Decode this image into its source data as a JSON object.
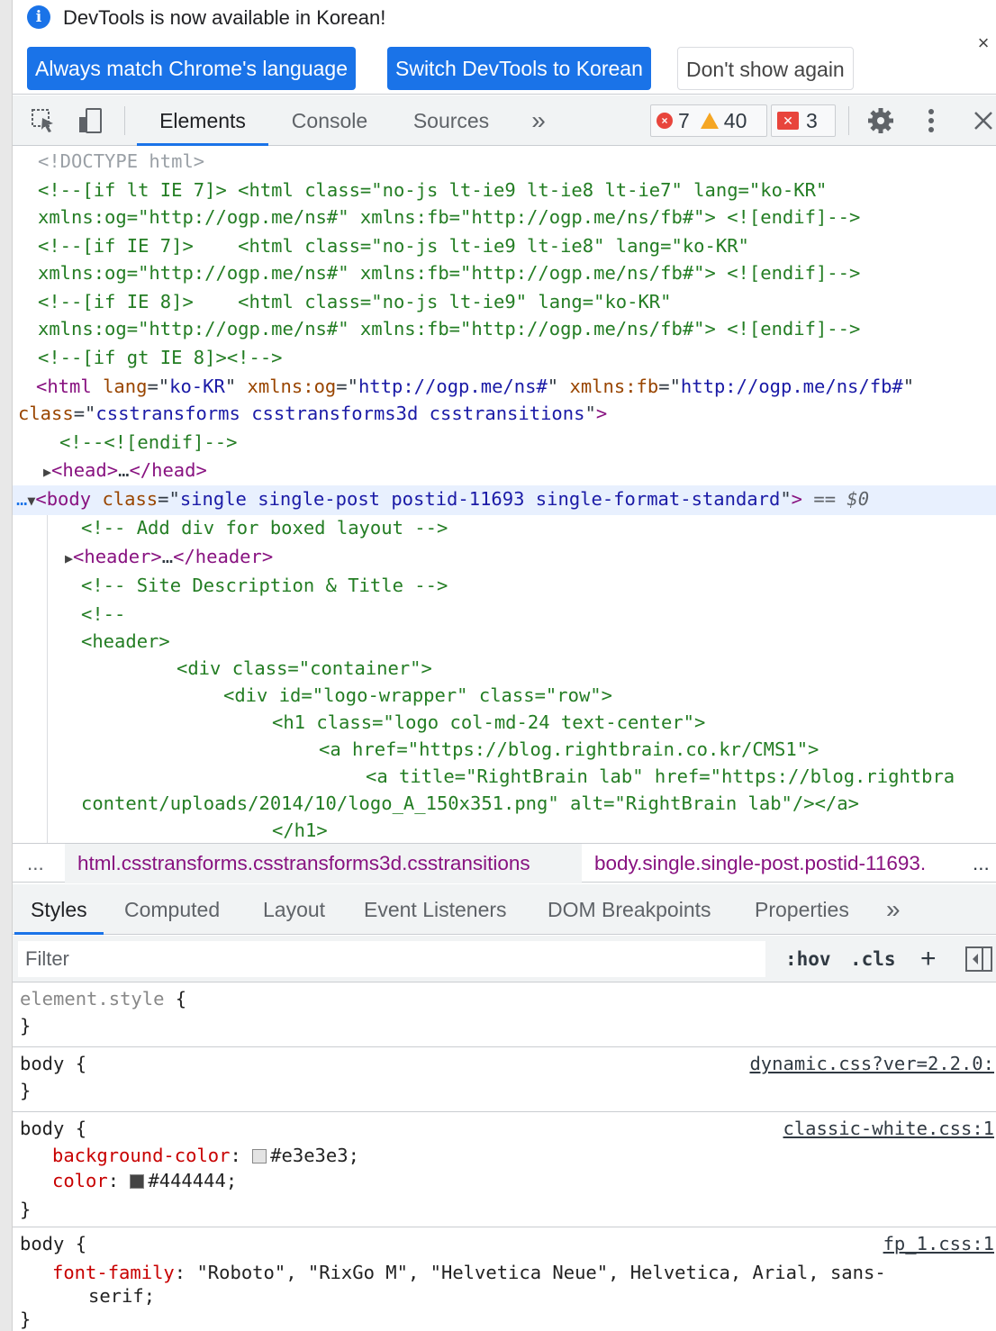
{
  "infobar": {
    "message": "DevTools is now available in Korean!",
    "btn_match": "Always match Chrome's language",
    "btn_switch": "Switch DevTools to Korean",
    "btn_dont_show": "Don't show again",
    "close": "×"
  },
  "toolbar": {
    "tabs": [
      "Elements",
      "Console",
      "Sources"
    ],
    "more": "»",
    "errors": "7",
    "warnings": "40",
    "issues": "3"
  },
  "tree": {
    "l1": "<!DOCTYPE html>",
    "l2": "<!--[if lt IE 7]> <html class=\"no-js lt-ie9 lt-ie8 lt-ie7\" lang=\"ko-KR\"",
    "l3": "xmlns:og=\"http://ogp.me/ns#\" xmlns:fb=\"http://ogp.me/ns/fb#\"> <![endif]-->",
    "l4": "<!--[if IE 7]>    <html class=\"no-js lt-ie9 lt-ie8\" lang=\"ko-KR\"",
    "l5": "xmlns:og=\"http://ogp.me/ns#\" xmlns:fb=\"http://ogp.me/ns/fb#\"> <![endif]-->",
    "l6": "<!--[if IE 8]>    <html class=\"no-js lt-ie9\" lang=\"ko-KR\"",
    "l7": "xmlns:og=\"http://ogp.me/ns#\" xmlns:fb=\"http://ogp.me/ns/fb#\"> <![endif]-->",
    "l8": "<!--[if gt IE 8]><!-->",
    "html_lang": "ko-KR",
    "html_og": "http://ogp.me/ns#",
    "html_fb": "http://ogp.me/ns/fb#",
    "html_class": "csstransforms csstransforms3d csstransitions",
    "l11": "<!--<![endif]-->",
    "body_class": "single single-post postid-11693 single-format-standard",
    "eq0": "== $0",
    "c1": "<!-- Add div for boxed layout -->",
    "c2": "<!-- Site Description & Title -->",
    "c3": "<!--",
    "c4": "<header>",
    "c5": "<div class=\"container\">",
    "c6": "<div id=\"logo-wrapper\" class=\"row\">",
    "c7": "<h1 class=\"logo col-md-24 text-center\">",
    "c8": "<a href=\"https://blog.rightbrain.co.kr/CMS1\">",
    "c9": "<a title=\"RightBrain lab\" href=\"https://blog.rightbra",
    "c10": "content/uploads/2014/10/logo_A_150x351.png\" alt=\"RightBrain lab\"/></a>",
    "c11": "</h1>"
  },
  "crumbs": {
    "dots": "...",
    "c1": "html.csstransforms.csstransforms3d.csstransitions",
    "c2": "body.single.single-post.postid-11693.",
    "more": "..."
  },
  "subtabs": [
    "Styles",
    "Computed",
    "Layout",
    "Event Listeners",
    "DOM Breakpoints",
    "Properties"
  ],
  "subtabs_more": "»",
  "filter": {
    "placeholder": "Filter",
    "hov": ":hov",
    "cls": ".cls",
    "plus": "+"
  },
  "styles": {
    "element_style": "element.style {",
    "src1": "dynamic.css?ver=2.2.0:",
    "src2": "classic-white.css:1",
    "bg_prop": "background-color",
    "bg_val": "#e3e3e3",
    "color_prop": "color",
    "color_val": "#444444",
    "src3": "fp_1.css:1",
    "ff_prop": "font-family",
    "ff_val": "\"Roboto\", \"RixGo M\", \"Helvetica Neue\", Helvetica, Arial, sans-",
    "ff_val2": "serif;",
    "swatch_bg": "#e3e3e3",
    "swatch_fg": "#444444"
  }
}
